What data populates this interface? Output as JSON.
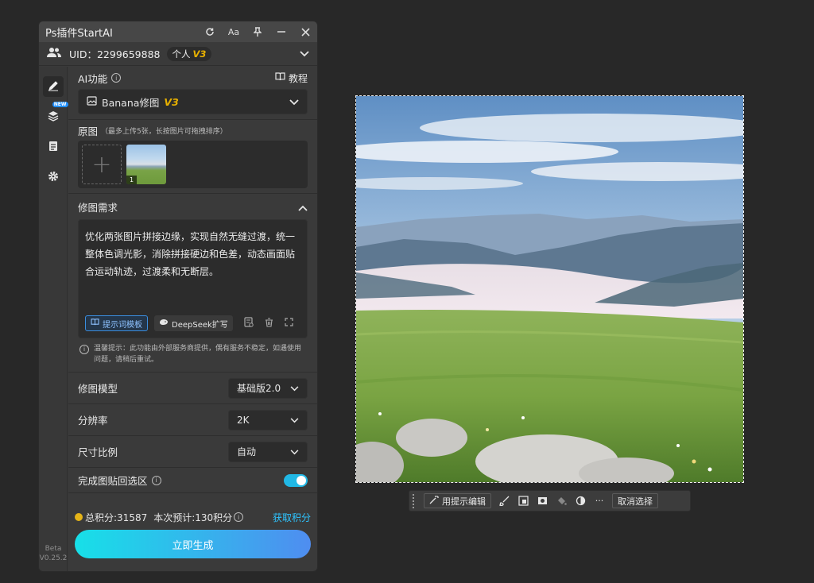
{
  "window": {
    "title": "Ps插件StartAI",
    "controls": [
      "refresh-icon",
      "font-icon",
      "pin-icon",
      "minimize-icon",
      "close-icon"
    ],
    "font_label": "Aa"
  },
  "user": {
    "uid_label": "UID：2299659888",
    "plan": "个人",
    "version_badge": "V3"
  },
  "sidebar": {
    "items": [
      "edit-icon",
      "layers-icon",
      "clipboard-icon",
      "gear-icon"
    ],
    "new_badge": "NEW",
    "beta_label": "Beta",
    "version": "V0.25.2"
  },
  "ai_function": {
    "label": "AI功能",
    "tutorial_label": "教程",
    "selected": "Banana修图",
    "selected_badge": "V3"
  },
  "original_images": {
    "label": "原图",
    "hint": "（最多上传5张，长按图片可拖拽排序）",
    "add_symbol": "+",
    "thumbs": [
      {
        "index": "1"
      }
    ]
  },
  "requirement": {
    "label": "修图需求",
    "text": "优化两张图片拼接边缘，实现自然无缝过渡，统一整体色调光影，消除拼接硬边和色差，动态画面贴合运动轨迹，过渡柔和无断层。",
    "template_button": "提示词模板",
    "deepseek_button": "DeepSeek扩写",
    "notice": "温馨提示：此功能由外部服务商提供，偶有服务不稳定，如遇使用问题，请稍后重试。"
  },
  "options": {
    "model_label": "修图模型",
    "model_value": "基础版2.0",
    "resolution_label": "分辨率",
    "resolution_value": "2K",
    "ratio_label": "尺寸比例",
    "ratio_value": "自动",
    "paste_back_label": "完成图贴回选区",
    "paste_back_on": true
  },
  "footer": {
    "total_points": "总积分:31587",
    "estimate": "本次预计:130积分",
    "get_points": "获取积分",
    "generate_button": "立即生成"
  },
  "context_toolbar": {
    "edit_prompt_button": "用提示编辑",
    "tools": [
      "brush-icon",
      "crop-icon",
      "mask-icon",
      "fill-icon",
      "contrast-icon",
      "more-icon"
    ],
    "more_label": "···",
    "deselect_button": "取消选择"
  },
  "colors": {
    "accent": "#21b8e5",
    "gradient_start": "#17e0e8",
    "gradient_end": "#4f8df0",
    "badge_gold": "#e8b100"
  }
}
